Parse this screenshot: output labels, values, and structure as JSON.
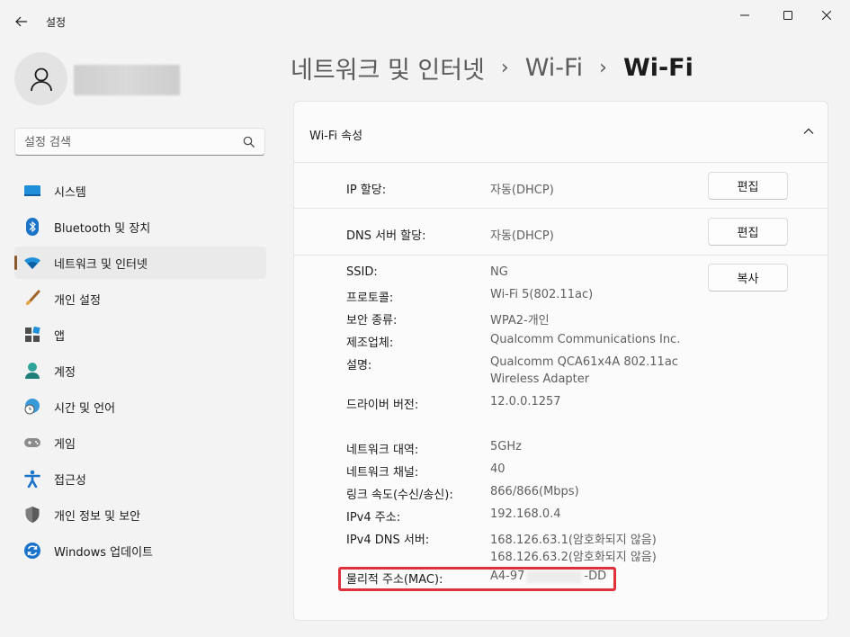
{
  "window": {
    "title": "설정"
  },
  "search": {
    "placeholder": "설정 검색"
  },
  "sidebar": {
    "items": [
      {
        "label": "시스템",
        "icon": "system-icon"
      },
      {
        "label": "Bluetooth 및 장치",
        "icon": "bluetooth-icon"
      },
      {
        "label": "네트워크 및 인터넷",
        "icon": "wifi-icon",
        "active": true
      },
      {
        "label": "개인 설정",
        "icon": "brush-icon"
      },
      {
        "label": "앱",
        "icon": "apps-icon"
      },
      {
        "label": "계정",
        "icon": "account-icon"
      },
      {
        "label": "시간 및 언어",
        "icon": "globe-clock-icon"
      },
      {
        "label": "게임",
        "icon": "gamepad-icon"
      },
      {
        "label": "접근성",
        "icon": "accessibility-icon"
      },
      {
        "label": "개인 정보 및 보안",
        "icon": "shield-icon"
      },
      {
        "label": "Windows 업데이트",
        "icon": "update-icon"
      }
    ]
  },
  "breadcrumb": [
    "네트워크 및 인터넷",
    "Wi-Fi",
    "Wi-Fi"
  ],
  "panel": {
    "title": "Wi-Fi 속성",
    "ip": {
      "label": "IP 할당:",
      "value": "자동(DHCP)",
      "button": "편집"
    },
    "dns": {
      "label": "DNS 서버 할당:",
      "value": "자동(DHCP)",
      "button": "편집"
    },
    "copy_button": "복사",
    "props": {
      "ssid": {
        "label": "SSID:",
        "value": "NG"
      },
      "protocol": {
        "label": "프로토콜:",
        "value": "Wi-Fi 5(802.11ac)"
      },
      "security": {
        "label": "보안 종류:",
        "value": "WPA2-개인"
      },
      "manufacturer": {
        "label": "제조업체:",
        "value": "Qualcomm Communications Inc."
      },
      "description": {
        "label": "설명:",
        "value1": "Qualcomm QCA61x4A 802.11ac",
        "value2": "Wireless Adapter"
      },
      "driver": {
        "label": "드라이버 버전:",
        "value": "12.0.0.1257"
      },
      "band": {
        "label": "네트워크 대역:",
        "value": "5GHz"
      },
      "channel": {
        "label": "네트워크 채널:",
        "value": "40"
      },
      "speed": {
        "label": "링크 속도(수신/송신):",
        "value": "866/866(Mbps)"
      },
      "ipv4": {
        "label": "IPv4 주소:",
        "value": "192.168.0.4"
      },
      "ipv4dns": {
        "label": "IPv4 DNS 서버:",
        "value1": "168.126.63.1(암호화되지 않음)",
        "value2": "168.126.63.2(암호화되지 않음)"
      },
      "mac": {
        "label": "물리적 주소(MAC):",
        "prefix": "A4-97",
        "suffix": "-DD"
      }
    }
  },
  "colors": {
    "accent": "#0067c0",
    "highlight": "#e0313a",
    "active_indicator": "#8a5a2e"
  }
}
